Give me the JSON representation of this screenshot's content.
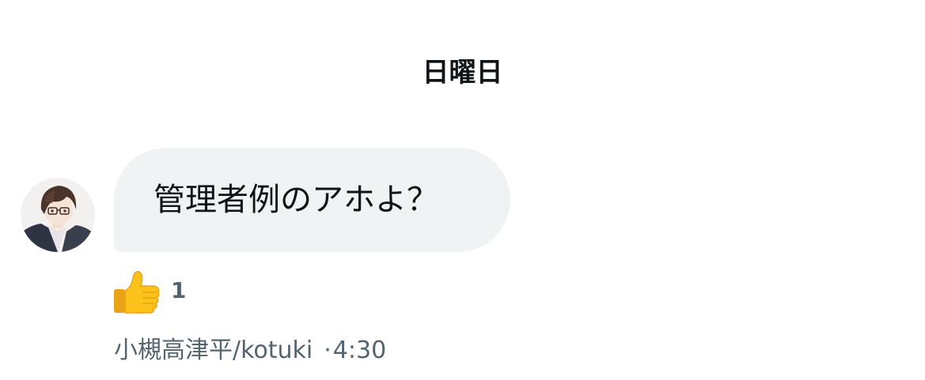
{
  "conversation": {
    "date_label": "日曜日"
  },
  "message": {
    "text": "管理者例のアホよ？",
    "avatar_icon": "user-avatar-icon",
    "bubble_color": "#eff3f4",
    "reaction": {
      "icon": "thumbs-up-icon",
      "count": "1"
    },
    "sender": "小槻高津平/kotuki",
    "separator": "·",
    "time": "4:30"
  }
}
